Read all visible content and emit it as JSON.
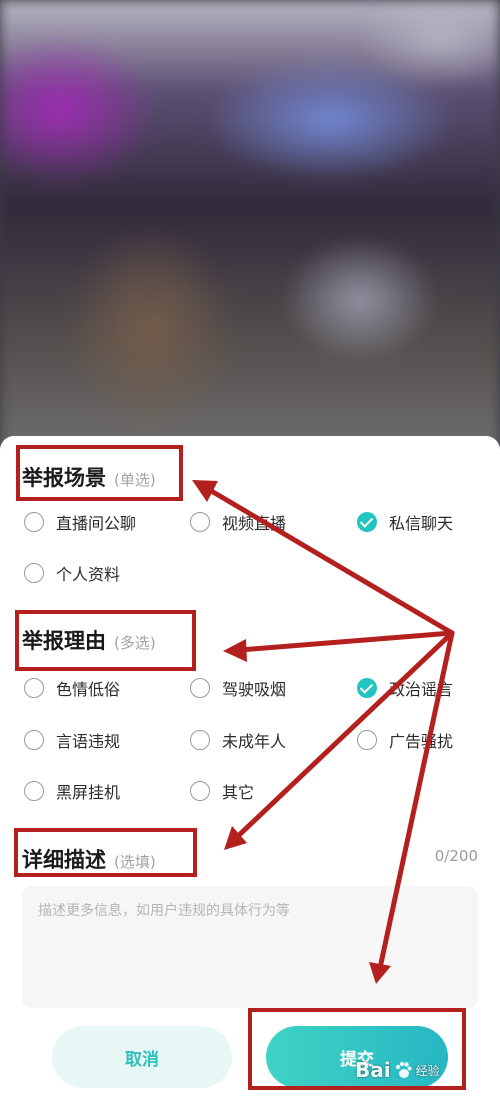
{
  "scene": {
    "title": "举报场景",
    "hint": "(单选)",
    "options": [
      {
        "label": "直播间公聊",
        "checked": false
      },
      {
        "label": "视频直播",
        "checked": false
      },
      {
        "label": "私信聊天",
        "checked": true
      },
      {
        "label": "个人资料",
        "checked": false
      }
    ]
  },
  "reason": {
    "title": "举报理由",
    "hint": "(多选)",
    "options": [
      {
        "label": "色情低俗",
        "checked": false
      },
      {
        "label": "驾驶吸烟",
        "checked": false
      },
      {
        "label": "政治谣言",
        "checked": true
      },
      {
        "label": "言语违规",
        "checked": false
      },
      {
        "label": "未成年人",
        "checked": false
      },
      {
        "label": "广告骚扰",
        "checked": false
      },
      {
        "label": "黑屏挂机",
        "checked": false
      },
      {
        "label": "其它",
        "checked": false
      }
    ]
  },
  "detail": {
    "title": "详细描述",
    "hint": "(选填)",
    "counter": "0/200",
    "placeholder": "描述更多信息，如用户违规的具体行为等",
    "value": ""
  },
  "buttons": {
    "cancel": "取消",
    "submit": "提交"
  },
  "watermark": {
    "brand": "Bai",
    "sub": "经验"
  },
  "colors": {
    "accent": "#22c4bf",
    "annotation": "#b3201e"
  }
}
